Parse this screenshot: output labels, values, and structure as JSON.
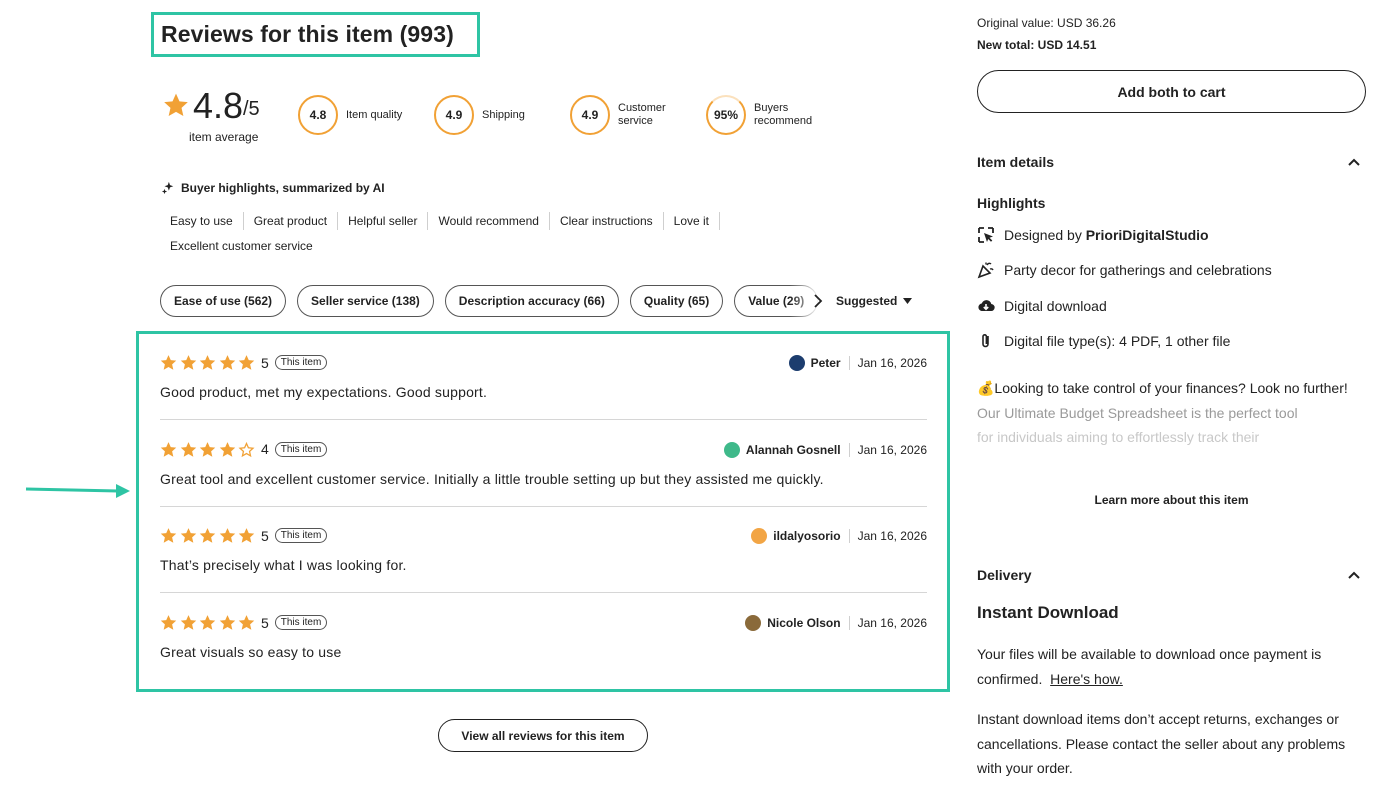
{
  "reviews": {
    "title": "Reviews for this item (993)",
    "average": "4.8",
    "average_denominator": "/5",
    "average_label": "item average",
    "metrics": [
      {
        "value": "4.8",
        "label": "Item quality"
      },
      {
        "value": "4.9",
        "label": "Shipping"
      },
      {
        "value": "4.9",
        "label": "Customer\nservice"
      },
      {
        "value": "95%",
        "label": "Buyers\nrecommend"
      }
    ],
    "ai_heading": "Buyer highlights, summarized by AI",
    "highlights": [
      "Easy to use",
      "Great product",
      "Helpful seller",
      "Would recommend",
      "Clear instructions",
      "Love it",
      "Excellent customer service"
    ],
    "filters": [
      "Ease of use (562)",
      "Seller service (138)",
      "Description accuracy (66)",
      "Quality (65)",
      "Value (29)"
    ],
    "sort_label": "Suggested",
    "items": [
      {
        "stars": 5,
        "rating": "5",
        "tag": "This item",
        "text": "Good product, met my expectations. Good support.",
        "author": "Peter",
        "date": "Jan 16, 2026",
        "avatar_color": "#1c3d6e"
      },
      {
        "stars": 4,
        "rating": "4",
        "tag": "This item",
        "text": "Great tool and excellent customer service. Initially a little trouble setting up but they assisted me quickly.",
        "author": "Alannah Gosnell",
        "date": "Jan 16, 2026",
        "avatar_color": "#3fb98a"
      },
      {
        "stars": 5,
        "rating": "5",
        "tag": "This item",
        "text": "That’s precisely what I was looking for.",
        "author": "ildalyosorio",
        "date": "Jan 16, 2026",
        "avatar_color": "#f2a545"
      },
      {
        "stars": 5,
        "rating": "5",
        "tag": "This item",
        "text": "Great visuals so easy to use",
        "author": "Nicole Olson",
        "date": "Jan 16, 2026",
        "avatar_color": "#8a6a3a"
      }
    ],
    "view_all": "View all reviews for this item"
  },
  "sidebar": {
    "original_value": "Original value: USD 36.26",
    "new_total": "New total: USD 14.51",
    "add_both": "Add both to cart",
    "item_details": "Item details",
    "highlights_title": "Highlights",
    "designed_by_prefix": "Designed by ",
    "designer": "PrioriDigitalStudio",
    "party_decor": "Party decor for gatherings and celebrations",
    "digital_download": "Digital download",
    "file_types": "Digital file type(s): 4 PDF, 1 other file",
    "desc_line1": "💰Looking to take control of your finances? Look no further!",
    "desc_line2": "Our Ultimate Budget Spreadsheet is the perfect tool",
    "desc_line3": "for individuals aiming to effortlessly track their",
    "learn_more": "Learn more about this item",
    "delivery": "Delivery",
    "instant_download": "Instant Download",
    "files_available": "Your files will be available to download once payment is confirmed.",
    "heres_how": "Here's how.",
    "returns_text": "Instant download items don’t accept returns, exchanges or cancellations. Please contact the seller about any problems with your order."
  },
  "colors": {
    "star": "#f1a135",
    "highlight_box": "#2ec4a4"
  }
}
